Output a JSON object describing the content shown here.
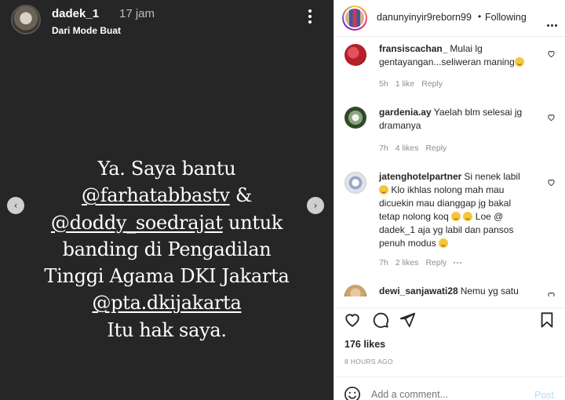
{
  "story": {
    "username": "dadek_1",
    "time": "17 jam",
    "subtitle": "Dari Mode Buat",
    "text": {
      "l1": "Ya. Saya bantu",
      "l2_mention": "@farhatabbastv",
      "l2_rest": " &",
      "l3_mention": "@doddy_soedrajat",
      "l3_rest": " untuk",
      "l4": "banding di Pengadilan",
      "l5": "Tinggi Agama DKI Jakarta",
      "l6_mention": "@pta.dkijakarta",
      "l7": "Itu hak saya."
    },
    "nav_prev": "‹",
    "nav_next": "›"
  },
  "header": {
    "account": "danunyinyir9reborn99",
    "separator": "•",
    "follow_status": "Following"
  },
  "comments": [
    {
      "username": "fransiscachan_",
      "text": "Mulai lg gentayangan...seliweran maning",
      "time": "5h",
      "likes": "1 like",
      "reply": "Reply",
      "avatar_color": "#b51f2a"
    },
    {
      "username": "gardenia.ay",
      "text": "Yaelah blm selesai jg dramanya",
      "time": "7h",
      "likes": "4 likes",
      "reply": "Reply",
      "avatar_color": "#2f4a28"
    },
    {
      "username": "jatenghotelpartner",
      "text_a": "Si nenek labil",
      "text_b": "Klo ikhlas nolong mah mau dicuekin mau dianggap jg bakal tetap nolong koq",
      "text_c": "Loe @ dadek_1 aja yg labil dan pansos penuh modus",
      "time": "7h",
      "likes": "2 likes",
      "reply": "Reply",
      "avatar_color": "#dfe3ec"
    },
    {
      "username": "dewi_sanjawati28",
      "text": "Nemu yg satu",
      "avatar_color": "#c9a46b"
    }
  ],
  "actions": {
    "likes": "176 likes",
    "time_ago": "8 HOURS AGO"
  },
  "add_comment": {
    "placeholder": "Add a comment...",
    "post_label": "Post"
  },
  "colors": {
    "story_bg": "#262626",
    "link_blue": "#0095f6",
    "post_disabled": "#b2dffc",
    "muted_text": "#8e8e8e"
  }
}
